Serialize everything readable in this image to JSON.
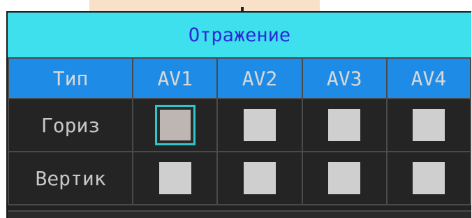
{
  "dialog": {
    "title": "Отражение"
  },
  "table": {
    "header": {
      "type_label": "Тип",
      "channels": [
        "AV1",
        "AV2",
        "AV3",
        "AV4"
      ]
    },
    "rows": [
      {
        "label": "Гориз",
        "checkboxes": [
          {
            "checked": false,
            "focused": true
          },
          {
            "checked": false,
            "focused": false
          },
          {
            "checked": false,
            "focused": false
          },
          {
            "checked": false,
            "focused": false
          }
        ]
      },
      {
        "label": "Вертик",
        "checkboxes": [
          {
            "checked": false,
            "focused": false
          },
          {
            "checked": false,
            "focused": false
          },
          {
            "checked": false,
            "focused": false
          },
          {
            "checked": false,
            "focused": false
          }
        ]
      }
    ]
  },
  "colors": {
    "title_background": "#3ee0ee",
    "title_text": "#2a2ad8",
    "header_background": "#1e8ce6",
    "row_background": "#242424",
    "focus_border": "#2ec6cc"
  }
}
